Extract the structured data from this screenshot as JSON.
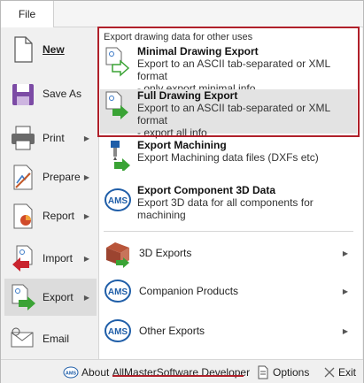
{
  "menubar": {
    "file_tab": "File"
  },
  "left_menu": [
    {
      "key": "new",
      "label": "New",
      "underline_index": 0,
      "arrow": false,
      "icon": "new-document-icon"
    },
    {
      "key": "saveas",
      "label": "Save As",
      "underline_index": 5,
      "arrow": false,
      "icon": "save-as-icon"
    },
    {
      "key": "print",
      "label": "Print",
      "underline_index": 0,
      "arrow": true,
      "icon": "printer-icon"
    },
    {
      "key": "prepare",
      "label": "Prepare",
      "underline_index": -1,
      "arrow": true,
      "icon": "prepare-icon"
    },
    {
      "key": "report",
      "label": "Report",
      "underline_index": -1,
      "arrow": true,
      "icon": "report-icon"
    },
    {
      "key": "import",
      "label": "Import",
      "underline_index": -1,
      "arrow": true,
      "icon": "import-icon"
    },
    {
      "key": "export",
      "label": "Export",
      "underline_index": -1,
      "arrow": true,
      "icon": "export-icon",
      "active": true
    },
    {
      "key": "email",
      "label": "Email",
      "underline_index": -1,
      "arrow": false,
      "icon": "email-icon"
    }
  ],
  "panel": {
    "section_title": "Export drawing data for other uses",
    "items": [
      {
        "title": "Minimal Drawing Export",
        "desc1": "Export to an ASCII tab-separated or XML format",
        "desc2": "- only export minimal info"
      },
      {
        "title": "Full Drawing Export",
        "desc1": "Export to an ASCII tab-separated or XML format",
        "desc2": "- export all info"
      },
      {
        "title": "Export Machining",
        "desc1": "Export Machining data files (DXFs etc)",
        "desc2": ""
      },
      {
        "title": "Export Component 3D Data",
        "desc1": "Export 3D data for all components for",
        "desc2": "machining"
      }
    ],
    "side_rows": [
      {
        "label": "3D Exports"
      },
      {
        "label": "Companion Products"
      },
      {
        "label": "Other Exports"
      }
    ]
  },
  "statusbar": {
    "about_prefix": "About ",
    "about_company": "AllMasterSoftware Developer",
    "options": "Options",
    "exit": "Exit"
  },
  "colors": {
    "highlight_red": "#b0202a",
    "accent_green": "#3aa335",
    "accent_blue": "#1f5ea8"
  }
}
